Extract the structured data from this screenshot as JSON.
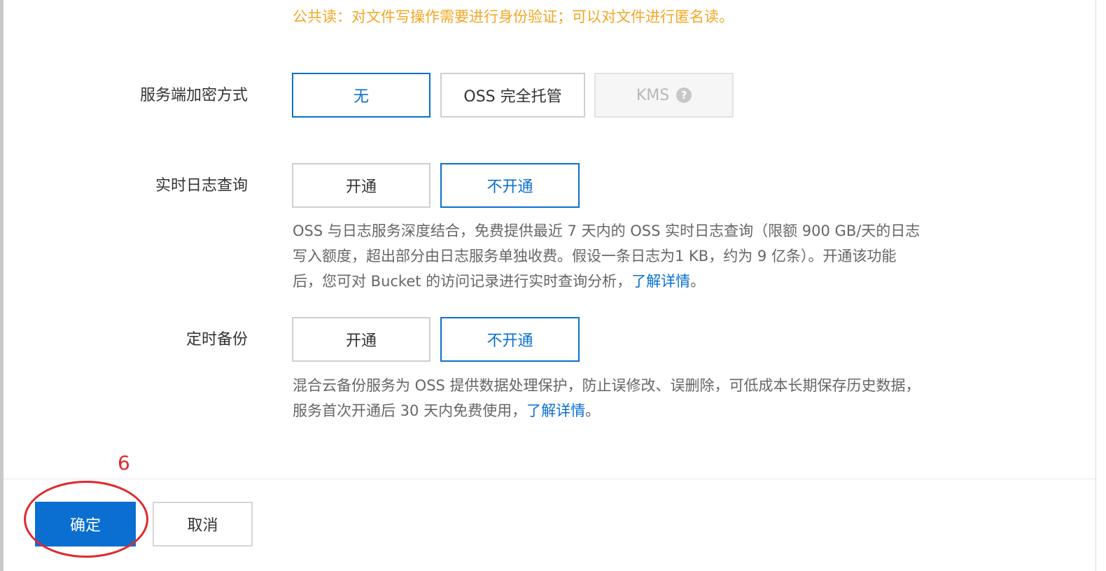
{
  "warning_text": "公共读：对文件写操作需要进行身份验证；可以对文件进行匿名读。",
  "encryption": {
    "label": "服务端加密方式",
    "options": [
      "无",
      "OSS 完全托管",
      "KMS"
    ],
    "selected": "无",
    "disabled": "KMS",
    "help_icon": "question-circle-icon"
  },
  "realtime_log": {
    "label": "实时日志查询",
    "options": [
      "开通",
      "不开通"
    ],
    "selected": "不开通",
    "desc_lines": [
      "OSS 与日志服务深度结合，免费提供最近 7 天内的 OSS 实时日志查询（限额 900 GB/天的日志",
      "写入额度，超出部分由日志服务单独收费。假设一条日志为1 KB，约为 9 亿条）。开通该功能",
      "后，您可对 Bucket 的访问记录进行实时查询分析，"
    ],
    "link": "了解详情",
    "link_suffix": "。"
  },
  "scheduled_backup": {
    "label": "定时备份",
    "options": [
      "开通",
      "不开通"
    ],
    "selected": "不开通",
    "desc_lines": [
      "混合云备份服务为 OSS 提供数据处理保护，防止误修改、误删除，可低成本长期保存历史数据，",
      "服务首次开通后 30 天内免费使用，"
    ],
    "link": "了解详情",
    "link_suffix": "。"
  },
  "footer": {
    "confirm": "确定",
    "cancel": "取消"
  },
  "annotation": {
    "number": "6",
    "color": "#e0292d"
  },
  "colors": {
    "primary": "#0a6fd0",
    "warning": "#f5a623"
  }
}
